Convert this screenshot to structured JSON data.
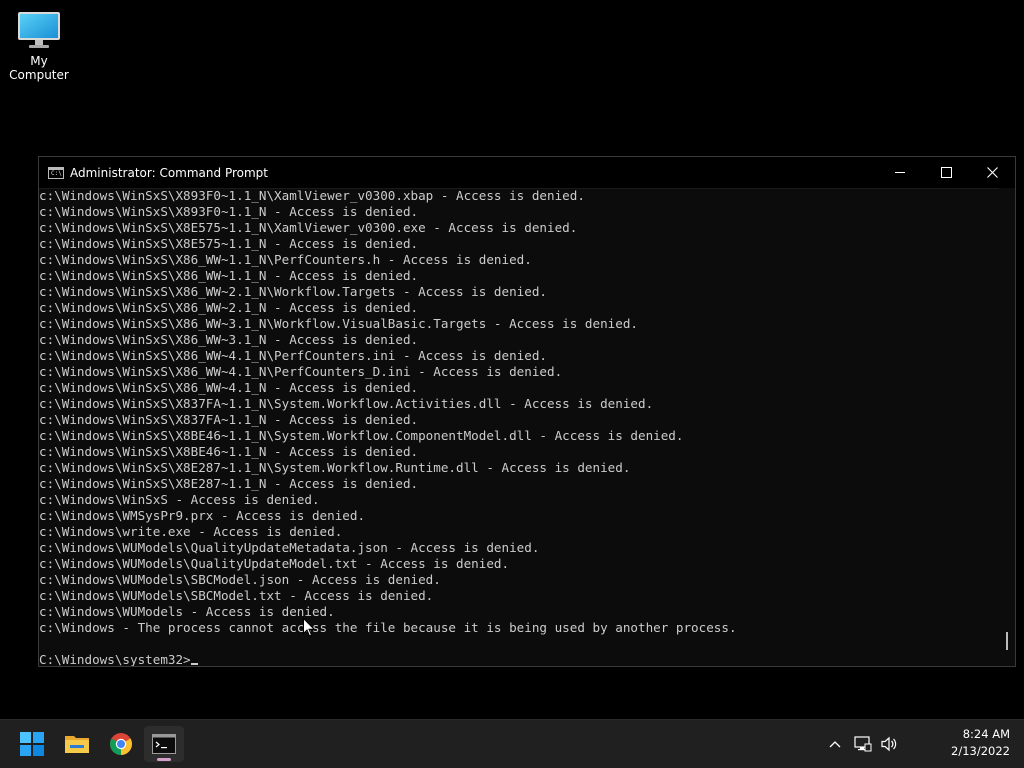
{
  "desktop": {
    "icon_label": "My Computer"
  },
  "window": {
    "title": "Administrator: Command Prompt",
    "icon_text": "C:\\",
    "buttons": {
      "minimize": "minimize",
      "maximize": "maximize",
      "close": "close"
    }
  },
  "console": {
    "lines": [
      "c:\\Windows\\WinSxS\\X893F0~1.1_N\\XamlViewer_v0300.xbap - Access is denied.",
      "c:\\Windows\\WinSxS\\X893F0~1.1_N - Access is denied.",
      "c:\\Windows\\WinSxS\\X8E575~1.1_N\\XamlViewer_v0300.exe - Access is denied.",
      "c:\\Windows\\WinSxS\\X8E575~1.1_N - Access is denied.",
      "c:\\Windows\\WinSxS\\X86_WW~1.1_N\\PerfCounters.h - Access is denied.",
      "c:\\Windows\\WinSxS\\X86_WW~1.1_N - Access is denied.",
      "c:\\Windows\\WinSxS\\X86_WW~2.1_N\\Workflow.Targets - Access is denied.",
      "c:\\Windows\\WinSxS\\X86_WW~2.1_N - Access is denied.",
      "c:\\Windows\\WinSxS\\X86_WW~3.1_N\\Workflow.VisualBasic.Targets - Access is denied.",
      "c:\\Windows\\WinSxS\\X86_WW~3.1_N - Access is denied.",
      "c:\\Windows\\WinSxS\\X86_WW~4.1_N\\PerfCounters.ini - Access is denied.",
      "c:\\Windows\\WinSxS\\X86_WW~4.1_N\\PerfCounters_D.ini - Access is denied.",
      "c:\\Windows\\WinSxS\\X86_WW~4.1_N - Access is denied.",
      "c:\\Windows\\WinSxS\\X837FA~1.1_N\\System.Workflow.Activities.dll - Access is denied.",
      "c:\\Windows\\WinSxS\\X837FA~1.1_N - Access is denied.",
      "c:\\Windows\\WinSxS\\X8BE46~1.1_N\\System.Workflow.ComponentModel.dll - Access is denied.",
      "c:\\Windows\\WinSxS\\X8BE46~1.1_N - Access is denied.",
      "c:\\Windows\\WinSxS\\X8E287~1.1_N\\System.Workflow.Runtime.dll - Access is denied.",
      "c:\\Windows\\WinSxS\\X8E287~1.1_N - Access is denied.",
      "c:\\Windows\\WinSxS - Access is denied.",
      "c:\\Windows\\WMSysPr9.prx - Access is denied.",
      "c:\\Windows\\write.exe - Access is denied.",
      "c:\\Windows\\WUModels\\QualityUpdateMetadata.json - Access is denied.",
      "c:\\Windows\\WUModels\\QualityUpdateModel.txt - Access is denied.",
      "c:\\Windows\\WUModels\\SBCModel.json - Access is denied.",
      "c:\\Windows\\WUModels\\SBCModel.txt - Access is denied.",
      "c:\\Windows\\WUModels - Access is denied.",
      "c:\\Windows - The process cannot access the file because it is being used by another process.",
      ""
    ],
    "prompt": "C:\\Windows\\system32>"
  },
  "taskbar": {
    "apps": [
      {
        "name": "start-icon",
        "active": false
      },
      {
        "name": "file-explorer-icon",
        "active": false
      },
      {
        "name": "chrome-icon",
        "active": false
      },
      {
        "name": "command-prompt-icon",
        "active": true
      }
    ],
    "tray_icons": [
      "chevron-up-icon",
      "network-icon",
      "volume-icon"
    ],
    "time": "8:24 AM",
    "date": "2/13/2022"
  },
  "colors": {
    "console_bg": "#0c0c0c",
    "console_text": "#cccccc",
    "taskbar_bg": "#202020",
    "active_indicator": "#d6a0c8"
  }
}
